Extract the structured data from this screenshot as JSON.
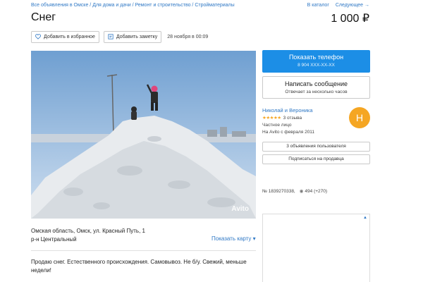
{
  "breadcrumbs": {
    "items": [
      "Все объявления в Омске",
      "Для дома и дачи",
      "Ремонт и строительство",
      "Стройматериалы"
    ],
    "separator": " / "
  },
  "topnav": {
    "catalog": "В каталог",
    "next": "Следующее →"
  },
  "listing": {
    "title": "Снег",
    "price": "1 000 ₽",
    "date": "28 ноября в 00:09",
    "address_line1": "Омская область, Омск, ул. Красный Путь, 1",
    "address_line2": "р-н Центральный",
    "show_map": "Показать карту ▾",
    "description": "Продаю снег. Естественного происхождения. Самовывоз. Не б/у. Свежий, меньше недели!",
    "photo_watermark": "Avito"
  },
  "actions": {
    "favorite": "Добавить в избранное",
    "note": "Добавить заметку"
  },
  "contact": {
    "phone_label": "Показать телефон",
    "phone_masked": "8 904 XXX-XX-XX",
    "message_label": "Написать сообщение",
    "message_sub": "Отвечает за несколько часов"
  },
  "seller": {
    "name": "Николай и Вероника",
    "stars": "★★★★★",
    "reviews": "3 отзыва",
    "type": "Частное лицо",
    "since": "На Avito с февраля 2011",
    "avatar_letter": "Н",
    "listings_button": "3 объявления пользователя",
    "subscribe_button": "Подписаться на продавца"
  },
  "ad_meta": {
    "number": "№ 1839270338,",
    "views": "494 (+270)"
  },
  "ad_box": {
    "tag": "▲"
  },
  "colors": {
    "link": "#2f78c5",
    "primary_button": "#1c8ee6",
    "avatar": "#f5a623",
    "stars": "#f6a623"
  }
}
